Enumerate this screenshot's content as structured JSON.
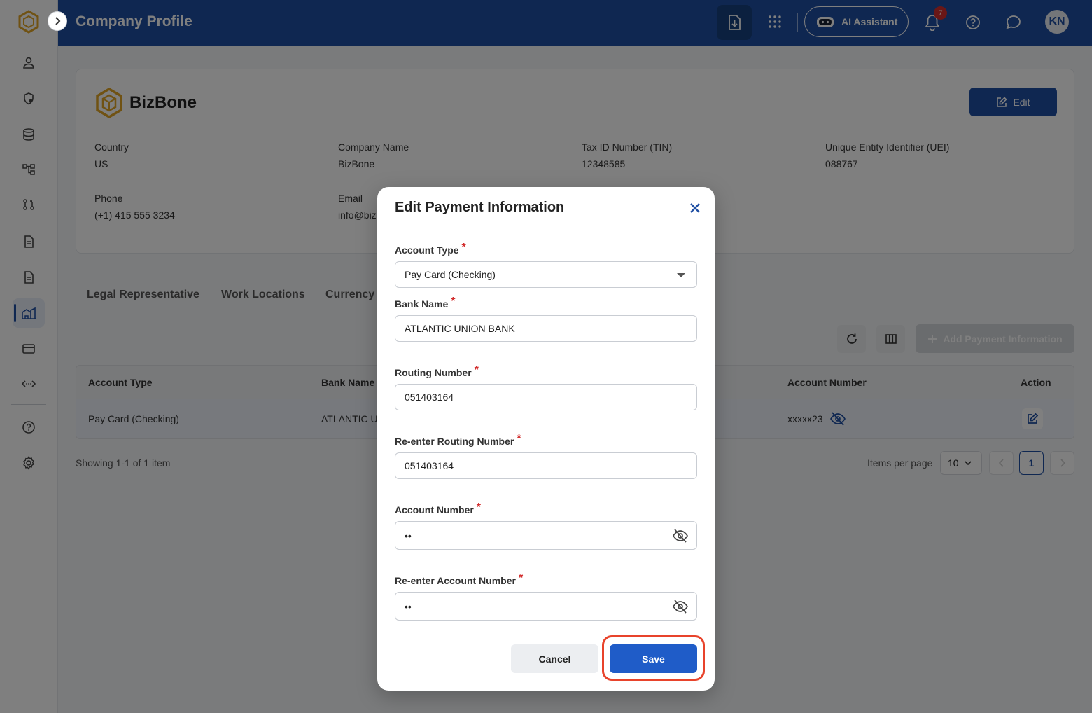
{
  "header": {
    "title": "Company Profile",
    "ai_assistant_label": "AI Assistant",
    "notification_count": "7",
    "avatar_initials": "KN"
  },
  "company": {
    "brand_name": "BizBone",
    "edit_label": "Edit",
    "fields": [
      {
        "label": "Country",
        "value": "US"
      },
      {
        "label": "Company Name",
        "value": "BizBone"
      },
      {
        "label": "Tax ID Number (TIN)",
        "value": "12348585"
      },
      {
        "label": "Unique Entity Identifier (UEI)",
        "value": "088767"
      },
      {
        "label": "Phone",
        "value": "(+1) 415 555 3234"
      },
      {
        "label": "Email",
        "value": "info@bizb"
      }
    ]
  },
  "tabs": [
    "Legal Representative",
    "Work Locations",
    "Currency"
  ],
  "toolbar": {
    "add_label": "Add Payment Information"
  },
  "table": {
    "headers": [
      "Account Type",
      "Bank Name",
      "Account Number",
      "Action"
    ],
    "rows": [
      {
        "account_type": "Pay Card (Checking)",
        "bank_name": "ATLANTIC U",
        "account_number": "xxxxx23"
      }
    ]
  },
  "pagination": {
    "showing": "Showing 1-1 of 1 item",
    "items_per_page_label": "Items per page",
    "items_per_page": "10",
    "current_page": "1"
  },
  "modal": {
    "title": "Edit Payment Information",
    "account_type_label": "Account Type",
    "account_type_value": "Pay Card (Checking)",
    "bank_name_label": "Bank Name",
    "bank_name_value": "ATLANTIC UNION BANK",
    "routing_label": "Routing Number",
    "routing_value": "051403164",
    "reenter_routing_label": "Re-enter Routing Number",
    "reenter_routing_value": "051403164",
    "account_number_label": "Account Number",
    "account_number_value": "••",
    "reenter_account_label": "Re-enter Account Number",
    "reenter_account_value": "••",
    "required_mark": "*",
    "cancel_label": "Cancel",
    "save_label": "Save"
  },
  "colors": {
    "primary": "#1f4fa3",
    "save_button": "#1f5cc8",
    "highlight": "#e8432b",
    "required": "#d32f2f"
  }
}
